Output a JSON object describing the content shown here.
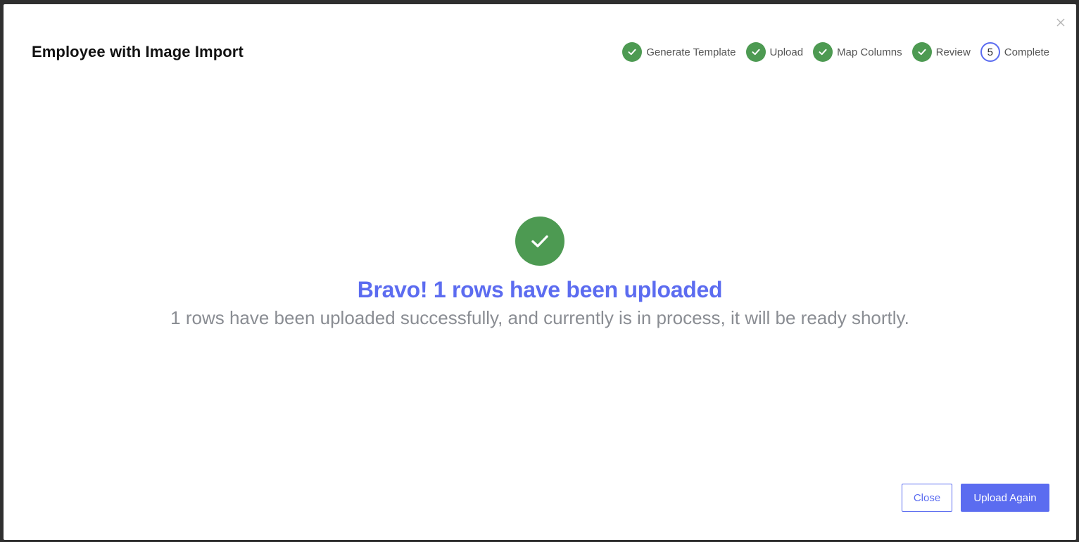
{
  "modal": {
    "title": "Employee with Image Import"
  },
  "stepper": {
    "steps": [
      {
        "label": "Generate Template",
        "state": "done"
      },
      {
        "label": "Upload",
        "state": "done"
      },
      {
        "label": "Map Columns",
        "state": "done"
      },
      {
        "label": "Review",
        "state": "done"
      },
      {
        "label": "Complete",
        "state": "active",
        "number": "5"
      }
    ]
  },
  "result": {
    "icon": "check-circle-icon",
    "headline": "Bravo! 1 rows have been uploaded",
    "message": "1 rows have been uploaded successfully, and currently is in process, it will be ready shortly."
  },
  "footer": {
    "close_label": "Close",
    "upload_again_label": "Upload Again"
  },
  "colors": {
    "accent": "#5b6cf0",
    "success": "#4d9a52",
    "muted_text": "#8a8d93"
  }
}
